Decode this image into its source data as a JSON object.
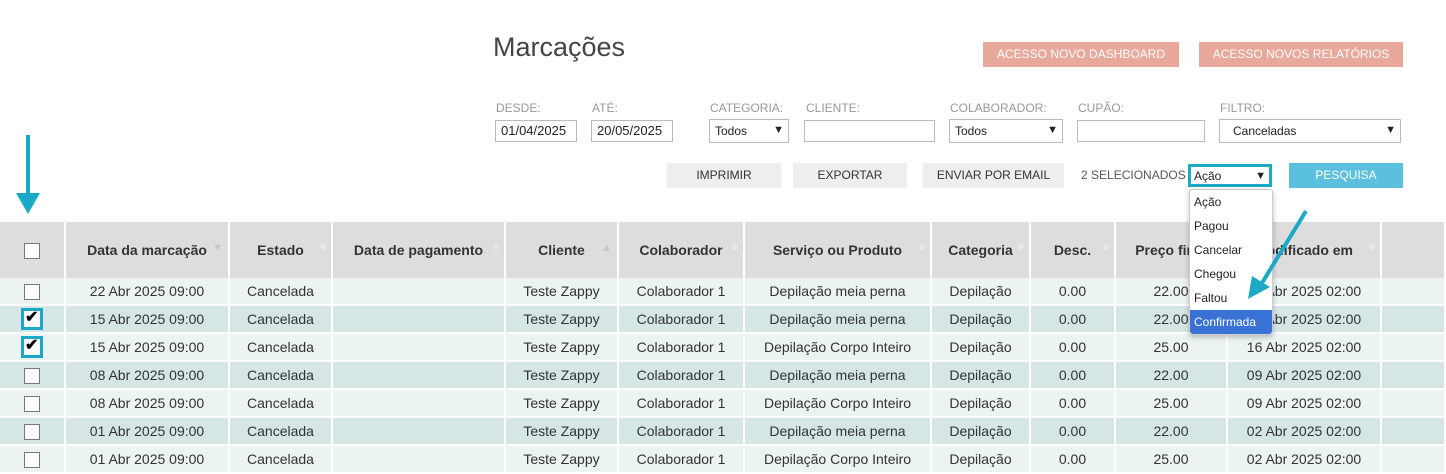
{
  "page": {
    "title": "Marcações"
  },
  "header_buttons": {
    "dashboard": "ACESSO NOVO DASHBOARD",
    "reports": "ACESSO NOVOS RELATÓRIOS"
  },
  "filters": {
    "desde": {
      "label": "DESDE:",
      "value": "01/04/2025"
    },
    "ate": {
      "label": "ATÉ:",
      "value": "20/05/2025"
    },
    "categoria": {
      "label": "CATEGORIA:",
      "value": "Todos"
    },
    "cliente": {
      "label": "CLIENTE:",
      "value": ""
    },
    "colaborador": {
      "label": "COLABORADOR:",
      "value": "Todos"
    },
    "cupao": {
      "label": "CUPÃO:",
      "value": ""
    },
    "filtro": {
      "label": "FILTRO:",
      "value": "Canceladas"
    }
  },
  "actions": {
    "print": "IMPRIMIR",
    "export": "EXPORTAR",
    "email": "ENVIAR POR EMAIL",
    "selected_count": "2 SELECIONADOS",
    "action_select": "Ação",
    "search": "PESQUISA"
  },
  "action_dropdown": {
    "options": [
      "Ação",
      "Pagou",
      "Cancelar",
      "Chegou",
      "Faltou",
      "Confirmada"
    ],
    "highlighted": "Confirmada"
  },
  "table": {
    "columns": [
      "Data da marcação",
      "Estado",
      "Data de pagamento",
      "Cliente",
      "Colaborador",
      "Serviço ou Produto",
      "Categoria",
      "Desc.",
      "Preço final",
      "Modificado em"
    ],
    "rows": [
      {
        "checked": false,
        "cells": [
          "22 Abr 2025 09:00",
          "Cancelada",
          "",
          "Teste Zappy",
          "Colaborador 1",
          "Depilação meia perna",
          "Depilação",
          "0.00",
          "22.00",
          "22 Abr 2025 02:00"
        ]
      },
      {
        "checked": true,
        "cells": [
          "15 Abr 2025 09:00",
          "Cancelada",
          "",
          "Teste Zappy",
          "Colaborador 1",
          "Depilação meia perna",
          "Depilação",
          "0.00",
          "22.00",
          "16 Abr 2025 02:00"
        ]
      },
      {
        "checked": true,
        "cells": [
          "15 Abr 2025 09:00",
          "Cancelada",
          "",
          "Teste Zappy",
          "Colaborador 1",
          "Depilação Corpo Inteiro",
          "Depilação",
          "0.00",
          "25.00",
          "16 Abr 2025 02:00"
        ]
      },
      {
        "checked": false,
        "cells": [
          "08 Abr 2025 09:00",
          "Cancelada",
          "",
          "Teste Zappy",
          "Colaborador 1",
          "Depilação meia perna",
          "Depilação",
          "0.00",
          "22.00",
          "09 Abr 2025 02:00"
        ]
      },
      {
        "checked": false,
        "cells": [
          "08 Abr 2025 09:00",
          "Cancelada",
          "",
          "Teste Zappy",
          "Colaborador 1",
          "Depilação Corpo Inteiro",
          "Depilação",
          "0.00",
          "25.00",
          "09 Abr 2025 02:00"
        ]
      },
      {
        "checked": false,
        "cells": [
          "01 Abr 2025 09:00",
          "Cancelada",
          "",
          "Teste Zappy",
          "Colaborador 1",
          "Depilação meia perna",
          "Depilação",
          "0.00",
          "22.00",
          "02 Abr 2025 02:00"
        ]
      },
      {
        "checked": false,
        "cells": [
          "01 Abr 2025 09:00",
          "Cancelada",
          "",
          "Teste Zappy",
          "Colaborador 1",
          "Depilação Corpo Inteiro",
          "Depilação",
          "0.00",
          "25.00",
          "02 Abr 2025 02:00"
        ]
      }
    ]
  },
  "colors": {
    "accent": "#1ba9c6",
    "header_button": "#e8a89c",
    "search_button": "#5bc0de",
    "row_light": "#ecf3f3",
    "row_dark": "#d6e6e6",
    "dropdown_highlight": "#3a71d4"
  }
}
